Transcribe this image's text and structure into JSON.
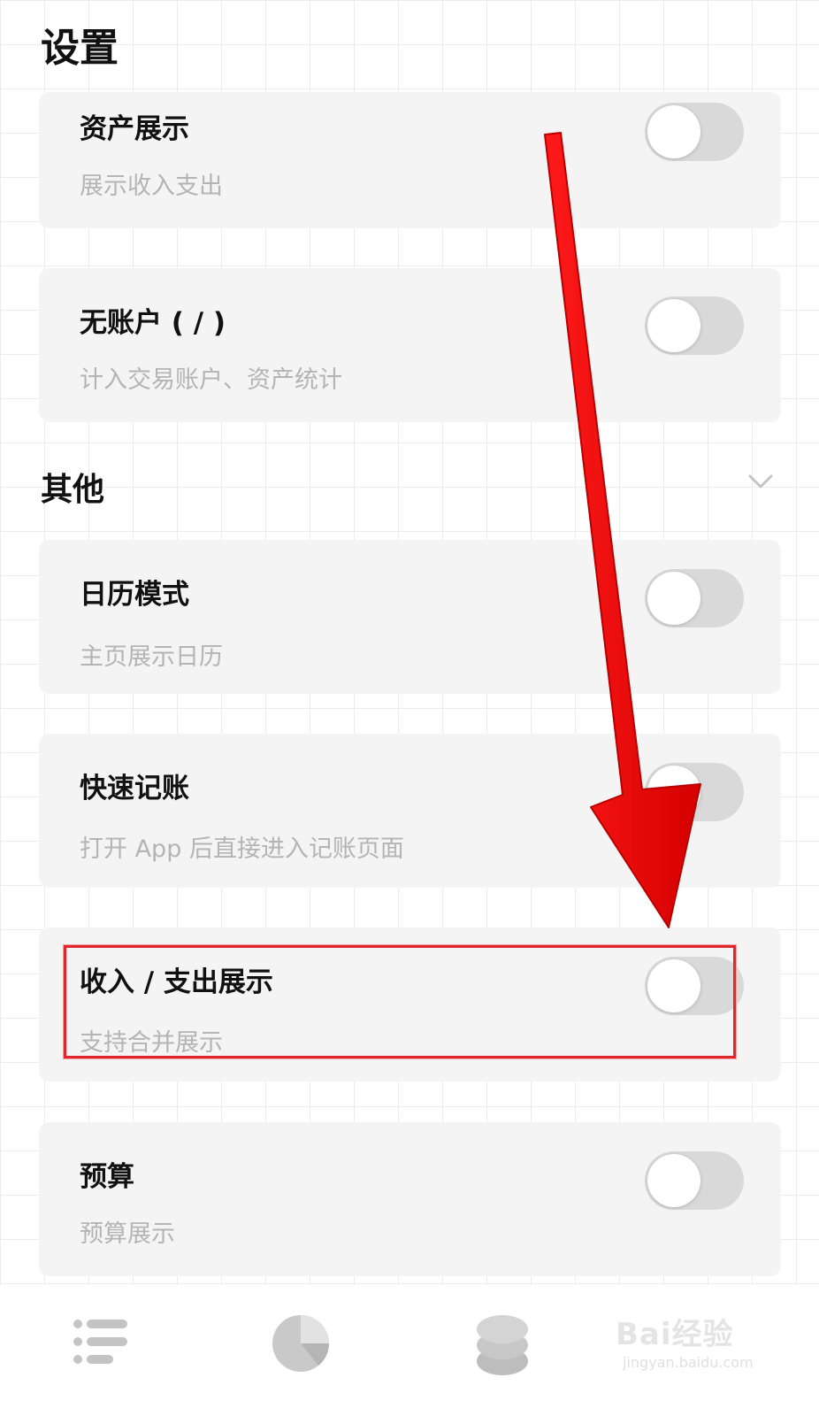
{
  "header": {
    "title": "设置"
  },
  "cards_top": [
    {
      "title": "资产展示",
      "subtitle": "展示收入支出",
      "toggle_on": false
    },
    {
      "title": "无账户 ( / )",
      "subtitle": "计入交易账户、资产统计",
      "toggle_on": false
    }
  ],
  "section": {
    "title": "其他",
    "chevron_icon": "chevron-down-icon"
  },
  "cards_other": [
    {
      "title": "日历模式",
      "subtitle": "主页展示日历",
      "toggle_on": false
    },
    {
      "title": "快速记账",
      "subtitle": "打开 App 后直接进入记账页面",
      "toggle_on": false
    },
    {
      "title": "收入 / 支出展示",
      "subtitle": "支持合并展示",
      "toggle_on": false
    },
    {
      "title": "预算",
      "subtitle": "预算展示",
      "toggle_on": false
    }
  ],
  "tabbar": {
    "tabs": [
      {
        "icon": "list-icon"
      },
      {
        "icon": "pie-chart-icon"
      },
      {
        "icon": "coins-stack-icon"
      }
    ]
  },
  "watermark": {
    "brand": "Bai经验",
    "url": "jingyan.baidu.com"
  },
  "colors": {
    "annotation_red": "#e3262b",
    "card_bg": "#f4f4f4",
    "toggle_off": "#d9d9d9"
  }
}
